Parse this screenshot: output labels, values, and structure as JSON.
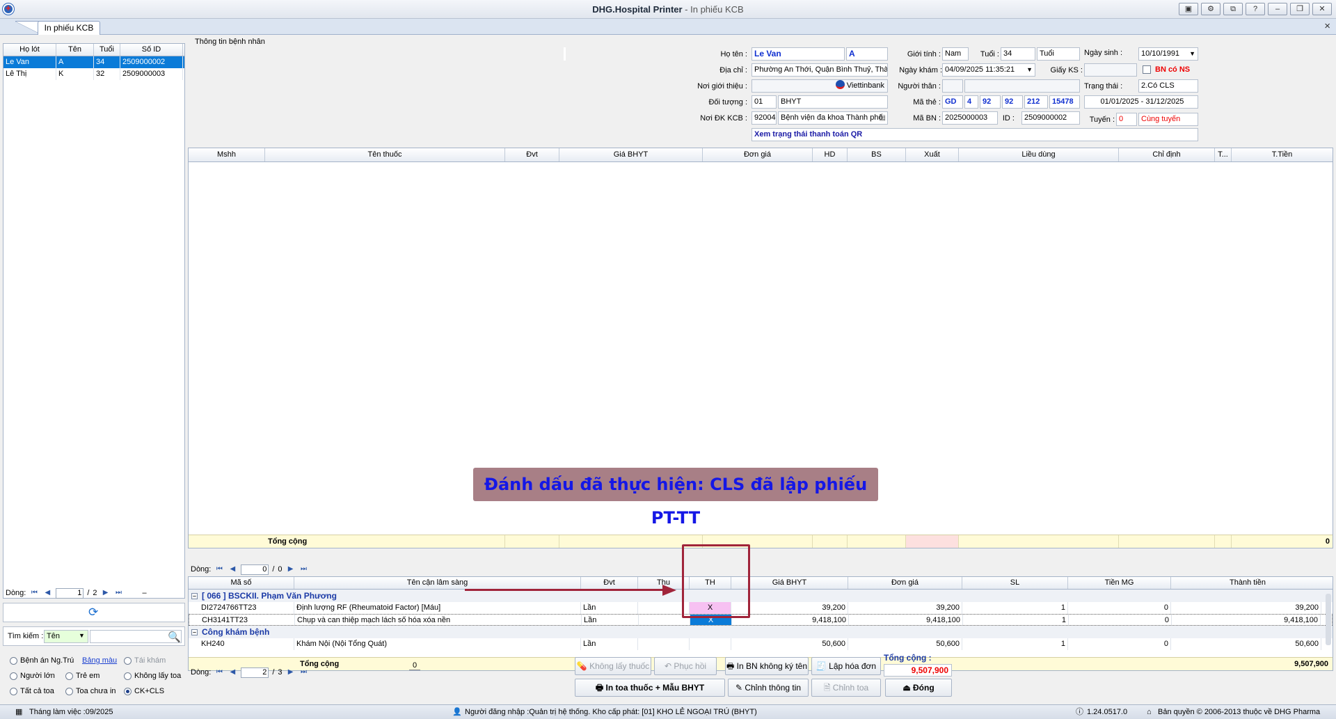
{
  "window": {
    "title": "DHG.Hospital Printer",
    "subtitle": " - In phiếu KCB"
  },
  "tab": {
    "label": "In phiếu KCB",
    "close": "×"
  },
  "patients": {
    "headers": [
      "Họ lót",
      "Tên",
      "Tuổi",
      "Số ID"
    ],
    "rows": [
      {
        "holot": "Le Van",
        "ten": "A",
        "tuoi": "34",
        "id": "2509000002"
      },
      {
        "holot": "Lê Thị",
        "ten": "K",
        "tuoi": "32",
        "id": "2509000003"
      }
    ],
    "pager": {
      "label": "Dòng:",
      "current": "1",
      "total": "2"
    }
  },
  "search": {
    "label": "Tìm kiếm :",
    "mode": "Tên",
    "value": ""
  },
  "filters": [
    {
      "label": "Bệnh án Ng.Trú",
      "on": false,
      "disabled": false
    },
    {
      "label": "Bảng màu",
      "link": true
    },
    {
      "label": "Tái khám",
      "on": false,
      "disabled": true
    },
    {
      "label": "Người lớn",
      "on": false
    },
    {
      "label": "Trẻ em",
      "on": false
    },
    {
      "label": "Không lấy toa",
      "on": false
    },
    {
      "label": "Tất cả toa",
      "on": false
    },
    {
      "label": "Toa chưa in",
      "on": false
    },
    {
      "label": "CK+CLS",
      "on": true
    }
  ],
  "info": {
    "section": "Thông tin bệnh nhân",
    "ho_ten_label": "Họ tên :",
    "ho": "Le Van",
    "ten": "A",
    "gioi_tinh_label": "Giới tính :",
    "gioi_tinh": "Nam",
    "tuoi_label": "Tuổi :",
    "tuoi": "34",
    "tuoi_unit": "Tuổi",
    "ngay_sinh_label": "Ngày sinh :",
    "ngay_sinh": "10/10/1991",
    "dia_chi_label": "Địa chỉ :",
    "dia_chi": "Phường An Thới, Quận Bình Thuỷ, Thành",
    "ngay_kham_label": "Ngày khám :",
    "ngay_kham": "04/09/2025  11:35:21",
    "giay_ks_label": "Giấy KS :",
    "giay_ks": "",
    "bn_co_ns": "BN có NS",
    "noi_gioi_thieu_label": "Nơi giới thiệu :",
    "bank": "Viettinbank",
    "nguoi_than_label": "Người thân :",
    "trang_thai_label": "Trạng thái :",
    "trang_thai": "2.Có CLS",
    "doi_tuong_label": "Đối tượng :",
    "doi_tuong_code": "01",
    "doi_tuong": "BHYT",
    "ma_the_label": "Mã thẻ :",
    "ma_the": [
      "GD",
      "4",
      "92",
      "92",
      "212",
      "15478"
    ],
    "han_the": "01/01/2025 - 31/12/2025",
    "noi_dk_label": "Nơi ĐK KCB :",
    "noi_dk_code": "92004",
    "noi_dk": "Bệnh viện đa khoa Thành phố",
    "ma_bn_label": "Mã BN :",
    "ma_bn": "2025000003",
    "id_label": "ID :",
    "id": "2509000002",
    "tuyen_label": "Tuyến :",
    "tuyen_code": "0",
    "tuyen": "Cùng tuyến",
    "qr": "Xem trạng thái thanh toán QR"
  },
  "drug_grid": {
    "headers": [
      "Mshh",
      "Tên thuốc",
      "Đvt",
      "Giá BHYT",
      "Đơn giá",
      "HD",
      "BS",
      "Xuất",
      "Liều dùng",
      "Chỉ định",
      "T...",
      "T.Tiền"
    ],
    "total_label": "Tổng cộng",
    "total": "0",
    "pager": {
      "label": "Dòng:",
      "current": "0",
      "total": "0"
    }
  },
  "banner": "Đánh dấu đã thực hiện: CLS đã lập phiếu PT-TT",
  "cls_grid": {
    "headers": [
      "Mã số",
      "Tên cận lâm sàng",
      "Đvt",
      "Thu",
      "TH",
      "Giá BHYT",
      "Đơn giá",
      "SL",
      "Tiền MG",
      "Thành tiền"
    ],
    "groups": [
      {
        "title": "[ 066 ] BSCKII. Phạm Văn Phương",
        "rows": [
          {
            "ma": "DI2724766TT23",
            "ten": "Định lượng RF (Rheumatoid Factor) [Máu]",
            "dvt": "Lần",
            "thu": "",
            "th": "X",
            "gia": "39,200",
            "don": "39,200",
            "sl": "1",
            "mg": "0",
            "tt": "39,200"
          },
          {
            "ma": "CH3141TT23",
            "ten": "Chụp và can thiệp mạch lách số hóa xóa nền",
            "dvt": "Lần",
            "thu": "",
            "th": "X",
            "gia": "9,418,100",
            "don": "9,418,100",
            "sl": "1",
            "mg": "0",
            "tt": "9,418,100"
          }
        ]
      },
      {
        "title": "Công khám bệnh",
        "rows": [
          {
            "ma": "KH240",
            "ten": "Khám Nội (Nội Tổng Quát)",
            "dvt": "Lần",
            "thu": "",
            "th": "",
            "gia": "50,600",
            "don": "50,600",
            "sl": "1",
            "mg": "0",
            "tt": "50,600"
          }
        ]
      }
    ],
    "total_label": "Tổng cộng",
    "total": "9,507,900",
    "pager": {
      "label": "Dòng:",
      "current": "2",
      "total": "3"
    }
  },
  "bottom": {
    "counter": "0",
    "btn_khong_lay_thuoc": "Không lấy thuốc",
    "btn_phuc_hoi": "Phục hồi",
    "btn_in_bn": "In BN không ký tên",
    "btn_lap_hoa_don": "Lập hóa đơn",
    "tong_cong_label": "Tổng cộng :",
    "tong_cong": "9,507,900",
    "btn_in_toa": "In toa thuốc + Mẫu BHYT",
    "btn_chinh_thong_tin": "Chỉnh thông tin",
    "btn_chinh_toa": "Chỉnh toa",
    "btn_dong": "Đóng"
  },
  "status": {
    "thang": "Tháng làm việc :09/2025",
    "user": "Người đăng nhập :Quản trị hệ thống. Kho cấp phát: [01] KHO LẺ NGOẠI TRÚ (BHYT)",
    "version": "1.24.0517.0",
    "copyright": "Bản quyền © 2006-2013 thuộc về DHG Pharma"
  },
  "colors": {
    "accent": "#0a7bd8",
    "banner_bg": "#a87f86",
    "banner_text": "#1517e6",
    "highlight_box": "#a0243a",
    "th_pink": "#f7c1f2"
  }
}
